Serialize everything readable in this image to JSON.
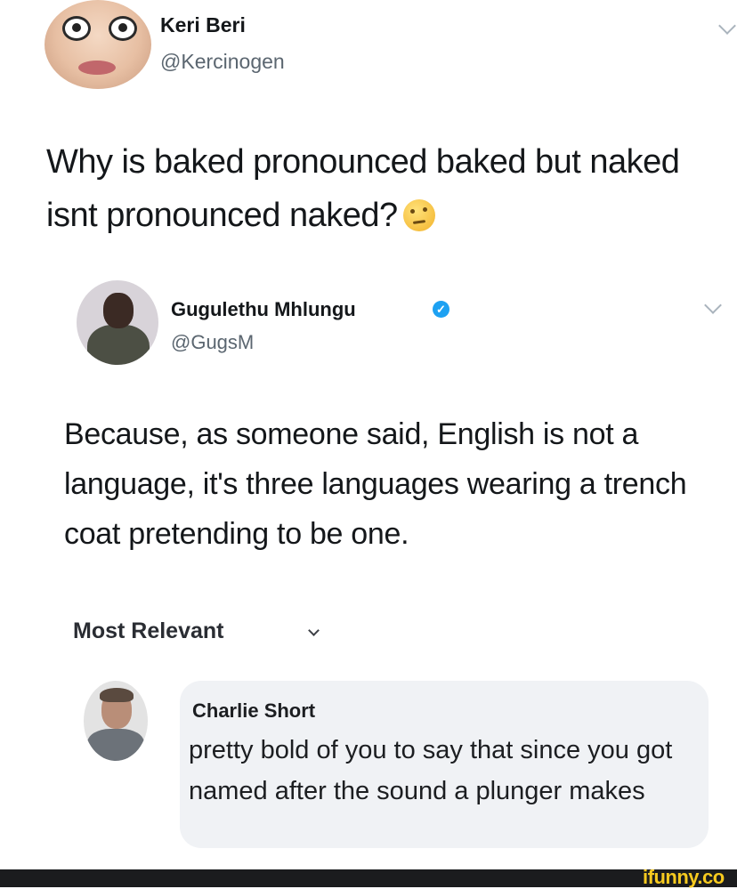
{
  "tweet": {
    "author": {
      "name": "Keri Beri",
      "handle": "@Kercinogen"
    },
    "text": "Why is baked pronounced baked but naked isnt pronounced naked?",
    "emoji": "thinking-face-emoji"
  },
  "reply": {
    "author": {
      "name": "Gugulethu Mhlungu",
      "handle": "@GugsM",
      "verified": true
    },
    "text": "Because, as someone said, English is not a language, it's three languages wearing a trench coat pretending to be one."
  },
  "comments": {
    "sort_label": "Most Relevant",
    "items": [
      {
        "name": "Charlie Short",
        "text": "pretty bold of you to say that since you got named after the sound a plunger makes"
      }
    ]
  },
  "watermark": "ifunny.co",
  "colors": {
    "verified_badge": "#1da1f2",
    "watermark": "#f7ca1f",
    "comment_bubble": "#f0f2f5"
  }
}
